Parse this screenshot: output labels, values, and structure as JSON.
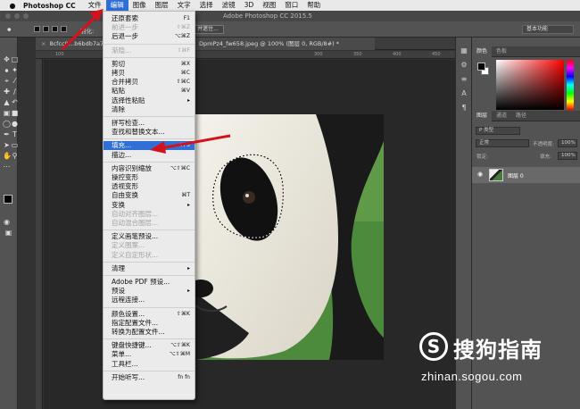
{
  "menubar": {
    "app_name": "Photoshop CC",
    "items": [
      "文件",
      "编辑",
      "图像",
      "图层",
      "文字",
      "选择",
      "滤镜",
      "3D",
      "视图",
      "窗口",
      "帮助"
    ]
  },
  "window": {
    "title": "Adobe Photoshop CC 2015.5"
  },
  "options_bar": {
    "feather_label": "羽化:",
    "refine_label": "选择并遮住...",
    "refine_partial": "并遮住...",
    "workspace": "基本功能"
  },
  "document": {
    "tab_left": "8cfcc9…b6bdb7a7",
    "tab_right": "DpmPz4_fw658.jpeg @ 100% (图层 0, RGB/8#) *",
    "ruler_ticks": [
      "100",
      "150",
      "200",
      "250",
      "300",
      "350",
      "400",
      "450",
      "500"
    ]
  },
  "edit_menu": {
    "items": [
      {
        "label": "还原套索",
        "shortcut": "F1",
        "disabled": false
      },
      {
        "label": "前进一步",
        "shortcut": "⇧⌘Z",
        "disabled": true
      },
      {
        "label": "后退一步",
        "shortcut": "⌥⌘Z",
        "disabled": false
      },
      {
        "sep": true
      },
      {
        "label": "渐隐...",
        "shortcut": "⇧⌘F",
        "disabled": true
      },
      {
        "sep": true
      },
      {
        "label": "剪切",
        "shortcut": "⌘X",
        "disabled": false
      },
      {
        "label": "拷贝",
        "shortcut": "⌘C",
        "disabled": false
      },
      {
        "label": "合并拷贝",
        "shortcut": "⇧⌘C",
        "disabled": false
      },
      {
        "label": "粘贴",
        "shortcut": "⌘V",
        "disabled": false
      },
      {
        "label": "选择性粘贴",
        "shortcut": "▸",
        "disabled": false
      },
      {
        "label": "清除",
        "shortcut": "",
        "disabled": false
      },
      {
        "sep": true
      },
      {
        "label": "拼写检查...",
        "shortcut": "",
        "disabled": false
      },
      {
        "label": "查找和替换文本...",
        "shortcut": "",
        "disabled": false
      },
      {
        "sep": true
      },
      {
        "label": "填充...",
        "shortcut": "⇧F5",
        "disabled": false,
        "highlight": true
      },
      {
        "label": "描边...",
        "shortcut": "",
        "disabled": false
      },
      {
        "sep": true
      },
      {
        "label": "内容识别缩放",
        "shortcut": "⌥⇧⌘C",
        "disabled": false
      },
      {
        "label": "操控变形",
        "shortcut": "",
        "disabled": false
      },
      {
        "label": "透视变形",
        "shortcut": "",
        "disabled": false
      },
      {
        "label": "自由变换",
        "shortcut": "⌘T",
        "disabled": false
      },
      {
        "label": "变换",
        "shortcut": "▸",
        "disabled": false
      },
      {
        "label": "自动对齐图层...",
        "shortcut": "",
        "disabled": true
      },
      {
        "label": "自动混合图层...",
        "shortcut": "",
        "disabled": true
      },
      {
        "sep": true
      },
      {
        "label": "定义画笔预设...",
        "shortcut": "",
        "disabled": false
      },
      {
        "label": "定义图案...",
        "shortcut": "",
        "disabled": true
      },
      {
        "label": "定义自定形状...",
        "shortcut": "",
        "disabled": true
      },
      {
        "sep": true
      },
      {
        "label": "清理",
        "shortcut": "▸",
        "disabled": false
      },
      {
        "sep": true
      },
      {
        "label": "Adobe PDF 预设...",
        "shortcut": "",
        "disabled": false
      },
      {
        "label": "预设",
        "shortcut": "▸",
        "disabled": false
      },
      {
        "label": "远程连接...",
        "shortcut": "",
        "disabled": false
      },
      {
        "sep": true
      },
      {
        "label": "颜色设置...",
        "shortcut": "⇧⌘K",
        "disabled": false
      },
      {
        "label": "指定配置文件...",
        "shortcut": "",
        "disabled": false
      },
      {
        "label": "转换为配置文件...",
        "shortcut": "",
        "disabled": false
      },
      {
        "sep": true
      },
      {
        "label": "键盘快捷键...",
        "shortcut": "⌥⇧⌘K",
        "disabled": false
      },
      {
        "label": "菜单...",
        "shortcut": "⌥⇧⌘M",
        "disabled": false
      },
      {
        "label": "工具栏...",
        "shortcut": "",
        "disabled": false
      },
      {
        "sep": true
      },
      {
        "label": "开始听写...",
        "shortcut": "fn fn",
        "disabled": false
      }
    ]
  },
  "panels": {
    "color_tabs": [
      "颜色",
      "色板"
    ],
    "layer_tabs": [
      "图层",
      "通道",
      "路径"
    ],
    "kind_filter": "P 类型",
    "blend_mode": "正常",
    "opacity_label": "不透明度:",
    "opacity_value": "100%",
    "lock_label": "锁定:",
    "fill_label": "填充:",
    "fill_value": "100%",
    "layer_name": "图层 0"
  },
  "watermark": {
    "logo": "S",
    "text": "搜狗指南",
    "url": "zhinan.sogou.com"
  },
  "colors": {
    "menu_highlight": "#2f6fd6",
    "annotation_red": "#d5121c"
  }
}
